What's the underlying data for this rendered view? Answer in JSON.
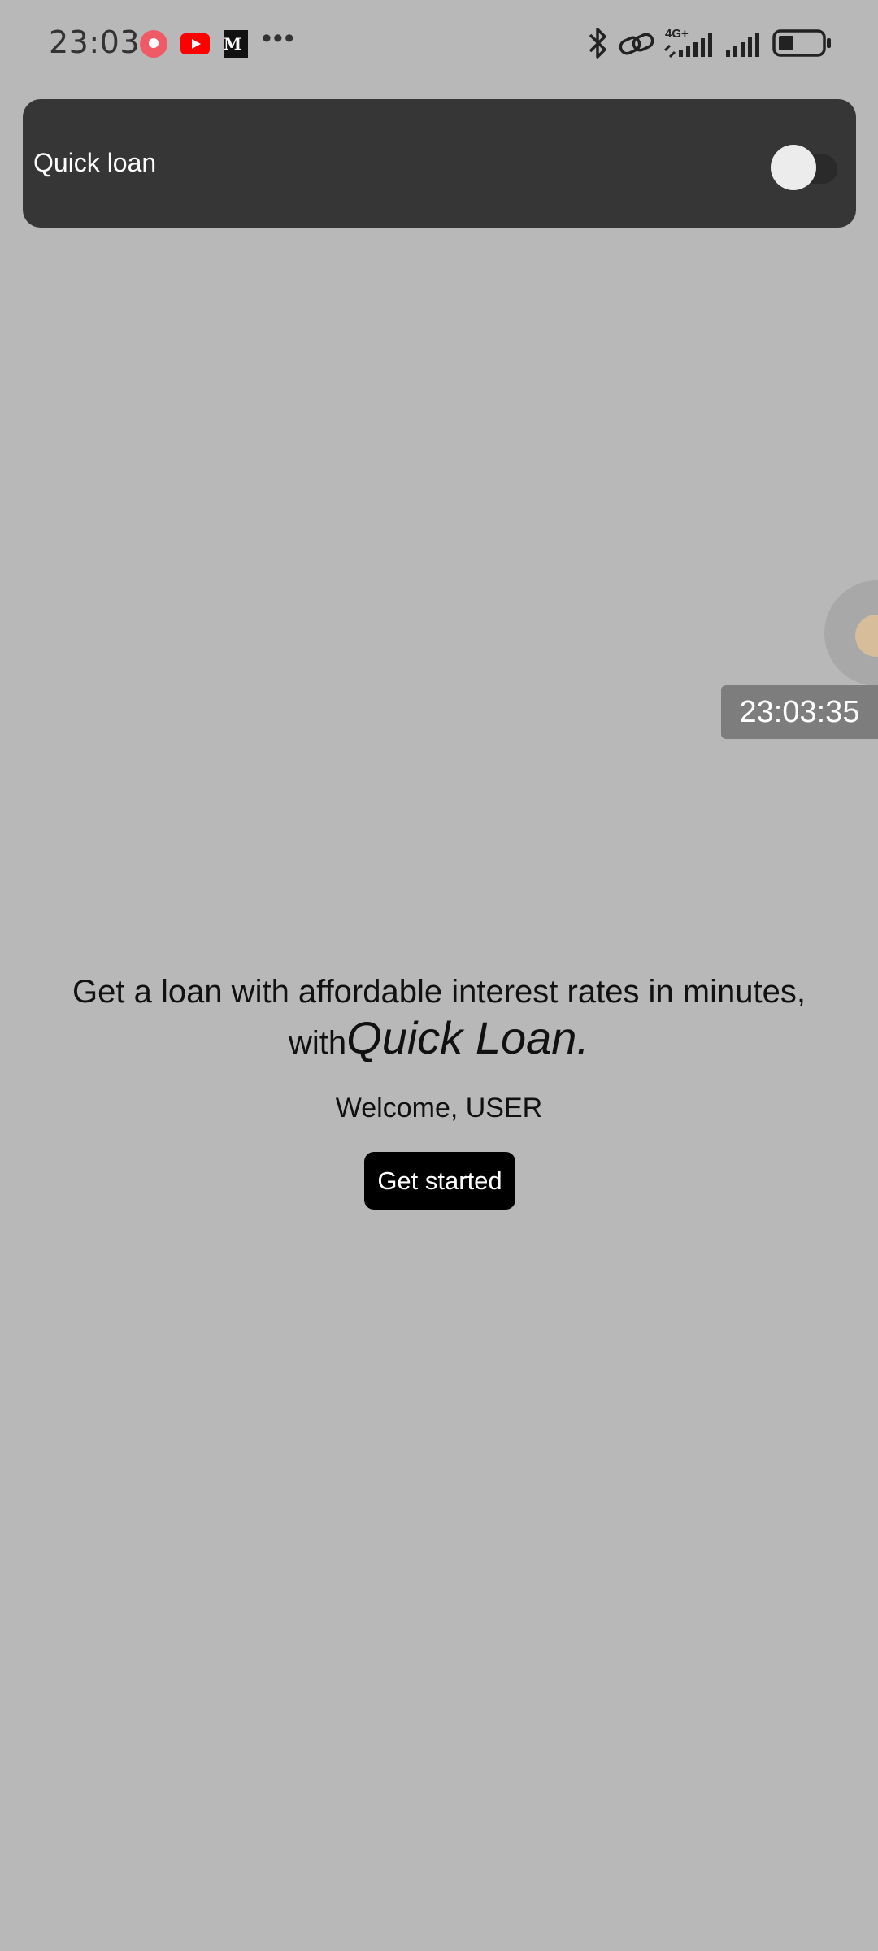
{
  "status_bar": {
    "time": "23:03",
    "notification_icons": [
      "music-icon",
      "youtube-icon",
      "medium-icon",
      "more-dots-icon"
    ],
    "medium_label": "M",
    "more_label": "•••",
    "right_icons": [
      "bluetooth-icon",
      "link-icon",
      "signal-icon",
      "signal-icon",
      "battery-icon"
    ],
    "network_label": "4G+",
    "battery_level": 0.35
  },
  "toolbar": {
    "title": "Quick loan",
    "toggle_on": false
  },
  "overlay": {
    "clock": "23:03:35"
  },
  "main": {
    "headline": "Get a loan with affordable interest rates in minutes,",
    "with_text": "with",
    "brand": "Quick Loan.",
    "welcome": "Welcome, USER",
    "cta_label": "Get started"
  },
  "colors": {
    "background": "#b8b8b8",
    "toolbar": "#363636",
    "button": "#000000"
  }
}
